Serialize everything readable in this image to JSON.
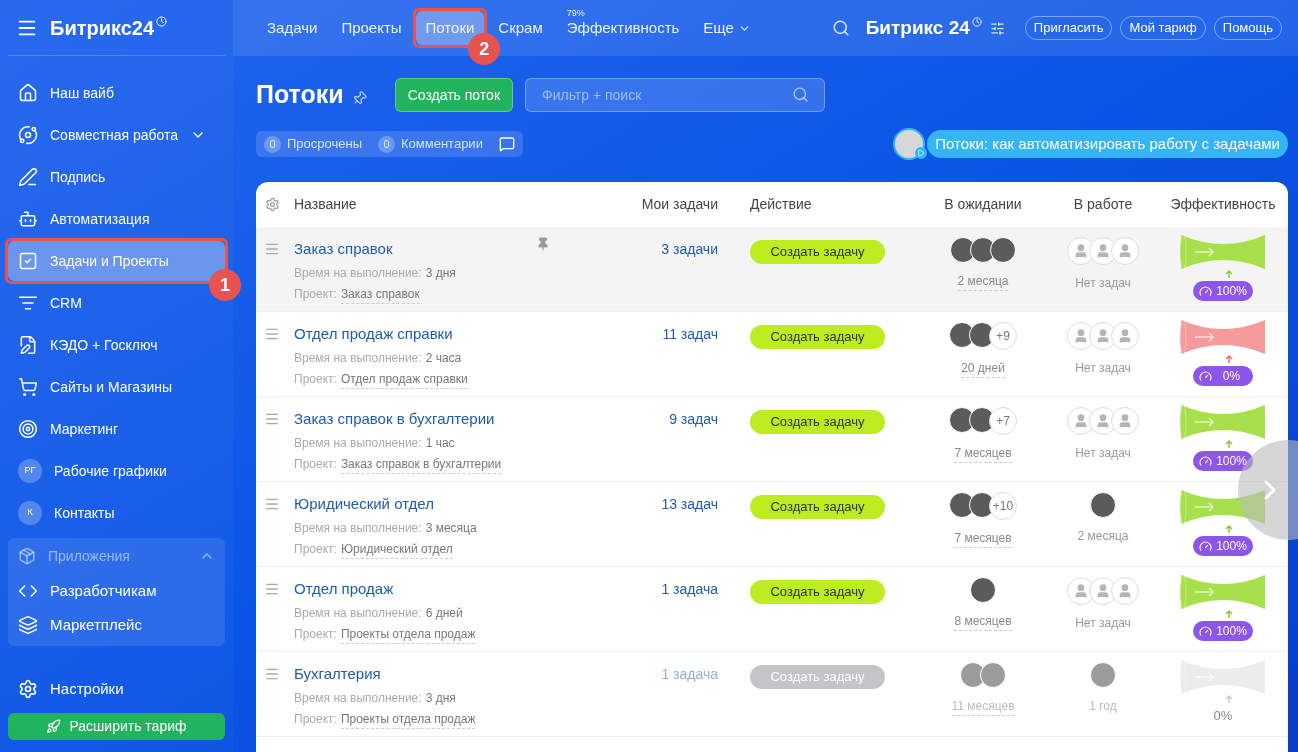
{
  "sidebar": {
    "logo": "Битрикс24",
    "items": [
      {
        "label": "Наш вайб",
        "selected": false
      },
      {
        "label": "Совместная работа",
        "selected": false,
        "expanded": false
      },
      {
        "label": "Подпись",
        "selected": false
      },
      {
        "label": "Автоматизация",
        "selected": false
      },
      {
        "label": "Задачи и Проекты",
        "selected": true,
        "callout": "1"
      },
      {
        "label": "CRM",
        "selected": false
      },
      {
        "label": "КЭДО + Госключ",
        "selected": false
      },
      {
        "label": "Сайты и Магазины",
        "selected": false
      },
      {
        "label": "Маркетинг",
        "selected": false
      },
      {
        "label": "Рабочие графики",
        "initials": "РГ",
        "selected": false
      },
      {
        "label": "Контакты",
        "initials": "К",
        "selected": false
      }
    ],
    "apps": {
      "label": "Приложения",
      "expanded": true,
      "children": [
        {
          "label": "Разработчикам"
        },
        {
          "label": "Маркетплейс"
        }
      ]
    },
    "settings": "Настройки",
    "upgrade_button": "Расширить тариф"
  },
  "topnav": {
    "tabs": [
      {
        "label": "Задачи",
        "selected": false
      },
      {
        "label": "Проекты",
        "selected": false
      },
      {
        "label": "Потоки",
        "selected": true,
        "callout": "2"
      },
      {
        "label": "Скрам",
        "selected": false
      },
      {
        "label": "Эффективность",
        "selected": false,
        "counter": "79%"
      },
      {
        "label": "Еще",
        "selected": false,
        "menu": true
      }
    ],
    "logo": "Битрикс 24",
    "buttons": [
      "Пригласить",
      "Мой тариф",
      "Помощь"
    ]
  },
  "page": {
    "title": "Потоки",
    "create_button": "Создать поток",
    "search": {
      "placeholder": "Фильтр + поиск"
    },
    "counters": [
      {
        "count": "0",
        "label": "Просрочены"
      },
      {
        "count": "0",
        "label": "Комментарии"
      }
    ],
    "promo": "Потоки: как автоматизировать работу с задачами"
  },
  "table": {
    "columns": [
      "Название",
      "Мои задачи",
      "Действие",
      "В ожидании",
      "В работе",
      "Эффективность"
    ],
    "rows": [
      {
        "name": "Заказ справок",
        "time_label": "Время на выполнение:",
        "time": "3 дня",
        "project_label": "Проект:",
        "project": "Заказ справок",
        "my_tasks": "3 задачи",
        "action": "Создать задачу",
        "disabled": false,
        "highlighted": true,
        "waiting": {
          "avatars": [
            {
              "kind": "photo"
            },
            {
              "kind": "photo"
            },
            {
              "kind": "photo"
            }
          ],
          "time": "2 месяца"
        },
        "in_work": {
          "avatars": [
            {
              "kind": "empty"
            },
            {
              "kind": "empty"
            },
            {
              "kind": "empty"
            }
          ],
          "time": "Нет задач"
        },
        "efficiency": {
          "kind": "good",
          "value": "100%"
        }
      },
      {
        "name": "Отдел продаж справки",
        "time_label": "Время на выполнение:",
        "time": "2 часа",
        "project_label": "Проект:",
        "project": "Отдел продаж справки",
        "my_tasks": "11 задач",
        "action": "Создать задачу",
        "disabled": false,
        "highlighted": false,
        "waiting": {
          "avatars": [
            {
              "kind": "photo"
            },
            {
              "kind": "photo"
            }
          ],
          "more": "+9",
          "time": "20 дней"
        },
        "in_work": {
          "avatars": [
            {
              "kind": "empty"
            },
            {
              "kind": "empty"
            },
            {
              "kind": "empty"
            }
          ],
          "time": "Нет задач"
        },
        "efficiency": {
          "kind": "bad",
          "value": "0%"
        }
      },
      {
        "name": "Заказ справок в бухгалтерии",
        "time_label": "Время на выполнение:",
        "time": "1 час",
        "project_label": "Проект:",
        "project": "Заказ справок в бухгалтерии",
        "my_tasks": "9 задач",
        "action": "Создать задачу",
        "disabled": false,
        "highlighted": false,
        "waiting": {
          "avatars": [
            {
              "kind": "photo"
            },
            {
              "kind": "photo"
            }
          ],
          "more": "+7",
          "time": "7 месяцев"
        },
        "in_work": {
          "avatars": [
            {
              "kind": "empty"
            },
            {
              "kind": "empty"
            },
            {
              "kind": "empty"
            }
          ],
          "time": "Нет задач"
        },
        "efficiency": {
          "kind": "good",
          "value": "100%"
        }
      },
      {
        "name": "Юридический отдел",
        "time_label": "Время на выполнение:",
        "time": "3 месяца",
        "project_label": "Проект:",
        "project": "Юридический отдел",
        "my_tasks": "13 задач",
        "action": "Создать задачу",
        "disabled": false,
        "highlighted": false,
        "waiting": {
          "avatars": [
            {
              "kind": "photo"
            },
            {
              "kind": "photo"
            }
          ],
          "more": "+10",
          "time": "7 месяцев"
        },
        "in_work": {
          "avatars": [
            {
              "kind": "photo"
            }
          ],
          "time": "2 месяца"
        },
        "efficiency": {
          "kind": "good",
          "value": "100%"
        }
      },
      {
        "name": "Отдел продаж",
        "time_label": "Время на выполнение:",
        "time": "6 дней",
        "project_label": "Проект:",
        "project": "Проекты отдела продаж",
        "my_tasks": "1 задача",
        "action": "Создать задачу",
        "disabled": false,
        "highlighted": false,
        "waiting": {
          "avatars": [
            {
              "kind": "photo"
            }
          ],
          "time": "8 месяцев"
        },
        "in_work": {
          "avatars": [
            {
              "kind": "empty"
            },
            {
              "kind": "empty"
            },
            {
              "kind": "empty"
            }
          ],
          "time": "Нет задач"
        },
        "efficiency": {
          "kind": "good",
          "value": "100%"
        }
      },
      {
        "name": "Бухгалтерия",
        "time_label": "Время на выполнение:",
        "time": "3 дня",
        "project_label": "Проект:",
        "project": "Проекты отдела продаж",
        "my_tasks": "1 задача",
        "action": "Создать задачу",
        "disabled": true,
        "highlighted": false,
        "waiting": {
          "avatars": [
            {
              "kind": "photo"
            },
            {
              "kind": "photo"
            }
          ],
          "time": "11 месяцев"
        },
        "in_work": {
          "avatars": [
            {
              "kind": "photo"
            }
          ],
          "time": "1 год"
        },
        "efficiency": {
          "kind": "inactive",
          "value": "0%"
        }
      }
    ]
  }
}
